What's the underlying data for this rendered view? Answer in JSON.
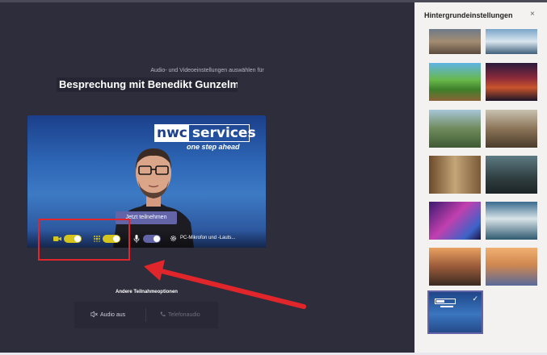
{
  "meeting": {
    "subtitle": "Audio- und Videoeinstellungen auswählen für",
    "title": "Besprechung mit Benedikt Gunzelmai",
    "join_label": "Jetzt teilnehmen",
    "device_label": "PC-Mikrofon und -Lauts...",
    "video_on": true,
    "blur_on": true,
    "mic_on": true
  },
  "logo": {
    "part1": "nwc",
    "part2": "services",
    "tagline": "one step ahead"
  },
  "other_options": {
    "label": "Andere Teilnahmeoptionen",
    "audio_off": "Audio aus",
    "phone_audio": "Telefonaudio"
  },
  "sidebar": {
    "title": "Hintergrundeinstellungen",
    "close": "×",
    "selected_check": "✓"
  },
  "colors": {
    "accent": "#6264a7",
    "toggle_on": "#d6c51d",
    "annotation_red": "#e0262b"
  }
}
